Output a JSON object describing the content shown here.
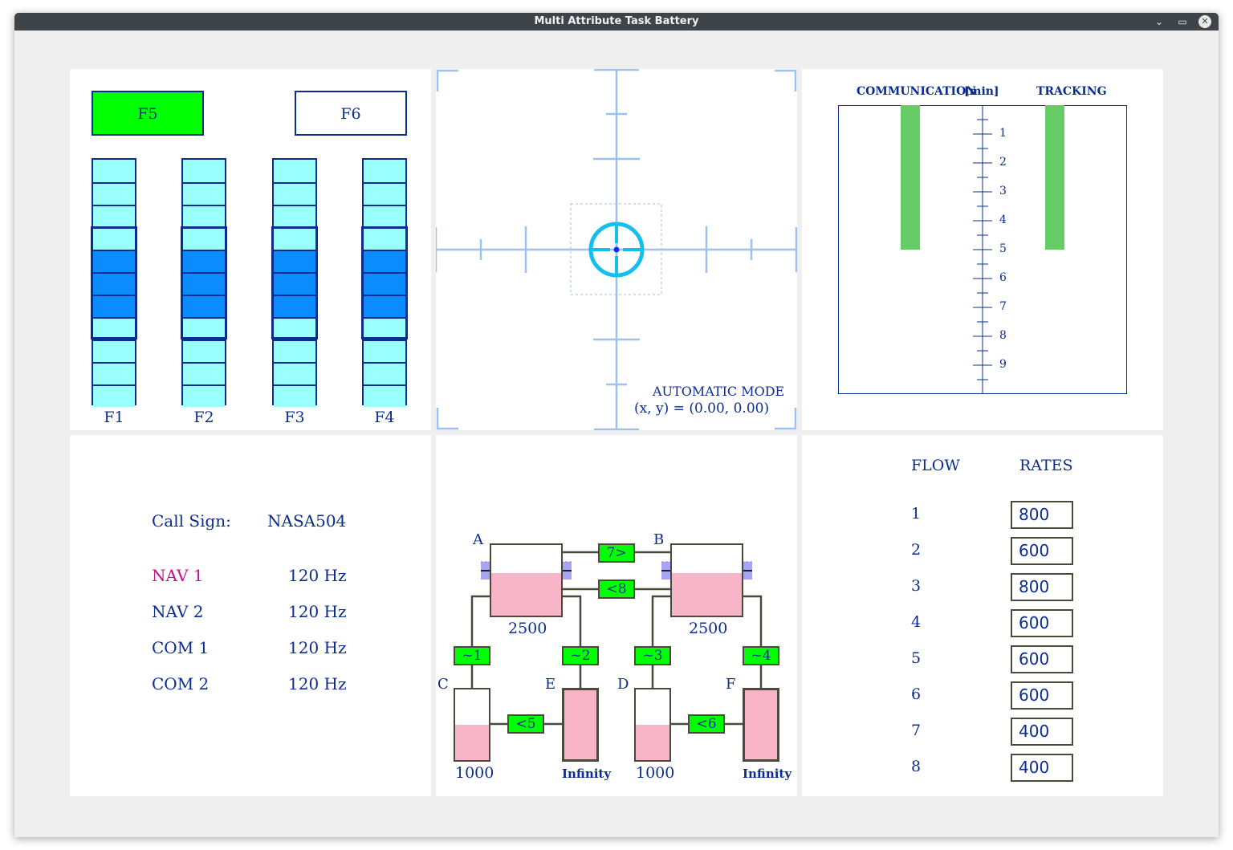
{
  "window": {
    "title": "Multi Attribute Task Battery",
    "controls": [
      "minimize-icon",
      "maximize-icon",
      "close-icon"
    ]
  },
  "sysmon": {
    "f5_label": "F5",
    "f6_label": "F6",
    "f5_color": "#00ff00",
    "scales": [
      {
        "label": "F1",
        "position": 4
      },
      {
        "label": "F2",
        "position": 4
      },
      {
        "label": "F3",
        "position": 4
      },
      {
        "label": "F4",
        "position": 4
      }
    ],
    "segment_count": 11
  },
  "track": {
    "mode_label": "AUTOMATIC MODE",
    "coords_label": "(x, y) = (0.00, 0.00)",
    "cursor_color": "#14bff0"
  },
  "scheduling": {
    "communication_label": "COMMUNICATION",
    "unit_label": "[min]",
    "tracking_label": "TRACKING",
    "ticks": [
      "1",
      "2",
      "3",
      "4",
      "5",
      "6",
      "7",
      "8",
      "9"
    ],
    "communication_bar_minutes": 5,
    "tracking_bar_minutes": 5,
    "bar_color": "#66cc66"
  },
  "communications": {
    "callsign_label": "Call Sign:",
    "callsign_value": "NASA504",
    "radios": [
      {
        "name": "NAV 1",
        "freq": "120 Hz",
        "selected": true
      },
      {
        "name": "NAV 2",
        "freq": "120 Hz",
        "selected": false
      },
      {
        "name": "COM 1",
        "freq": "120 Hz",
        "selected": false
      },
      {
        "name": "COM 2",
        "freq": "120 Hz",
        "selected": false
      }
    ]
  },
  "resman": {
    "tank_a": {
      "letter": "A",
      "level": "2500"
    },
    "tank_b": {
      "letter": "B",
      "level": "2500"
    },
    "tank_c": {
      "letter": "C",
      "level": "1000"
    },
    "tank_d": {
      "letter": "D",
      "level": "1000"
    },
    "tank_e": {
      "letter": "E",
      "level": "Infinity"
    },
    "tank_f": {
      "letter": "F",
      "level": "Infinity"
    },
    "pumps": {
      "p1": "~1",
      "p2": "~2",
      "p3": "~3",
      "p4": "~4",
      "p5": "<5",
      "p6": "<6",
      "p7": "7>",
      "p8": "<8"
    },
    "pump_color": "#00ff00",
    "fuel_color": "#f7b5c7"
  },
  "pump_status": {
    "flow_header": "FLOW",
    "rates_header": "RATES",
    "rows": [
      {
        "flow": "1",
        "rate": "800"
      },
      {
        "flow": "2",
        "rate": "600"
      },
      {
        "flow": "3",
        "rate": "800"
      },
      {
        "flow": "4",
        "rate": "600"
      },
      {
        "flow": "5",
        "rate": "600"
      },
      {
        "flow": "6",
        "rate": "600"
      },
      {
        "flow": "7",
        "rate": "400"
      },
      {
        "flow": "8",
        "rate": "400"
      }
    ]
  }
}
